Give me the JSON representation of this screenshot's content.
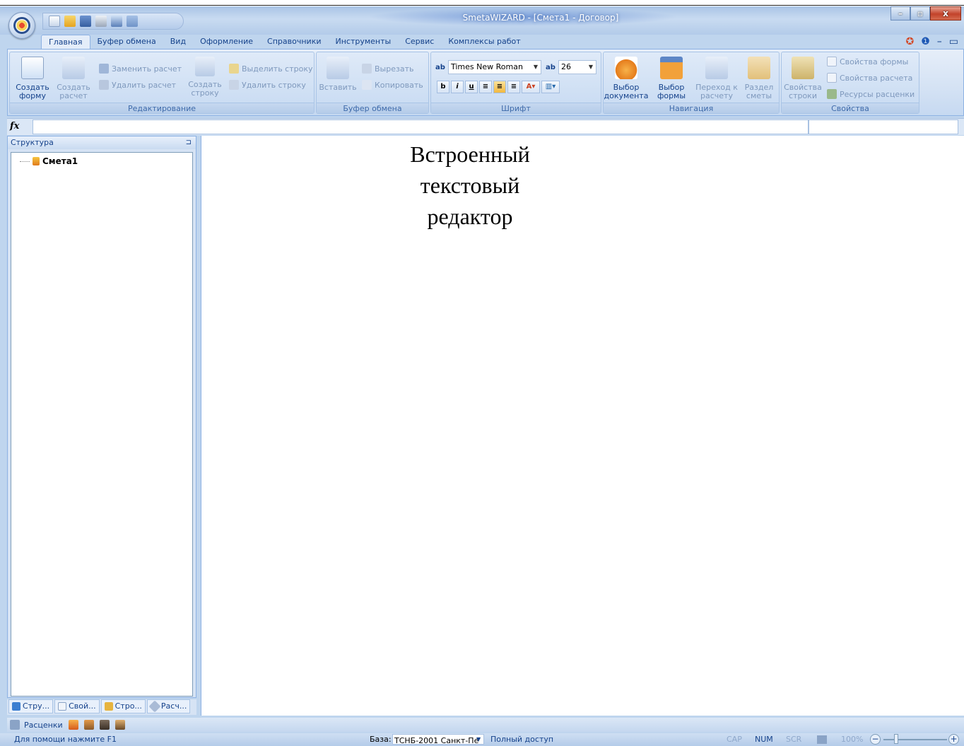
{
  "window": {
    "title": "SmetaWIZARD - [Смета1 - Договор]",
    "accent": "#bfd5ee"
  },
  "tabs": [
    "Главная",
    "Буфер обмена",
    "Вид",
    "Оформление",
    "Справочники",
    "Инструменты",
    "Сервис",
    "Комплексы работ"
  ],
  "ribbon": {
    "edit": {
      "label": "Редактирование",
      "create_form": "Создать форму",
      "create_calc": "Создать расчет",
      "replace_calc": "Заменить расчет",
      "delete_calc": "Удалить расчет",
      "create_row": "Создать строку",
      "select_row": "Выделить строку",
      "delete_row": "Удалить строку"
    },
    "clipboard": {
      "label": "Буфер обмена",
      "paste": "Вставить",
      "cut": "Вырезать",
      "copy": "Копировать"
    },
    "font": {
      "label": "Шрифт",
      "family": "Times New Roman",
      "size": "26",
      "bold": "b",
      "italic": "i",
      "underline": "u"
    },
    "nav": {
      "label": "Навигация",
      "choose_doc": "Выбор документа",
      "choose_form": "Выбор формы",
      "goto_calc": "Переход к расчету",
      "section": "Раздел сметы"
    },
    "props": {
      "label": "Свойства",
      "row_props": "Свойства строки",
      "form_props": "Свойства формы",
      "calc_props": "Свойства расчета",
      "price_resources": "Ресурсы расценки"
    }
  },
  "panel": {
    "title": "Структура",
    "tree_node": "Смета1",
    "tabs": [
      "Стру...",
      "Свой...",
      "Стро...",
      "Расч..."
    ]
  },
  "editor": {
    "lines": [
      "Встроенный",
      "текстовый",
      "редактор"
    ]
  },
  "bottom_bar": {
    "prices": "Расценки"
  },
  "status": {
    "help": "Для помощи нажмите F1",
    "base_label": "База:",
    "base_value": "ТСНБ-2001 Санкт-Пе",
    "access": "Полный доступ",
    "cap": "CAP",
    "num": "NUM",
    "scr": "SCR",
    "zoom": "100%"
  }
}
